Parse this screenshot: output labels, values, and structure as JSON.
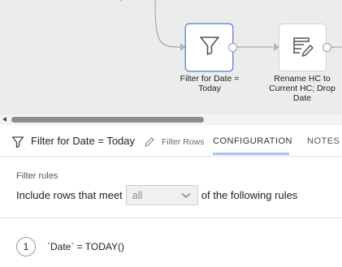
{
  "canvas": {
    "nodes": [
      {
        "id": "filter",
        "icon": "filter-icon",
        "caption": "Filter for Date =\nToday",
        "selected": true
      },
      {
        "id": "rename",
        "icon": "table-edit-icon",
        "caption": "Rename HC to\nCurrent HC; Drop\nDate",
        "selected": false
      }
    ]
  },
  "panel": {
    "title": "Filter for Date = Today",
    "type_label": "Filter Rows",
    "tabs": [
      {
        "label": "CONFIGURATION",
        "active": true
      },
      {
        "label": "NOTES",
        "active": false
      }
    ]
  },
  "config": {
    "section_label": "Filter rules",
    "prefix_text": "Include rows that meet",
    "match_select": {
      "value": "all"
    },
    "suffix_text": "of the following rules",
    "rules": [
      {
        "number": "1",
        "expression": "`Date` = TODAY()"
      }
    ]
  },
  "colors": {
    "canvas_bg": "#ececec",
    "selection_border": "#6f8fd8",
    "active_tab_underline": "#a9c4ea"
  }
}
